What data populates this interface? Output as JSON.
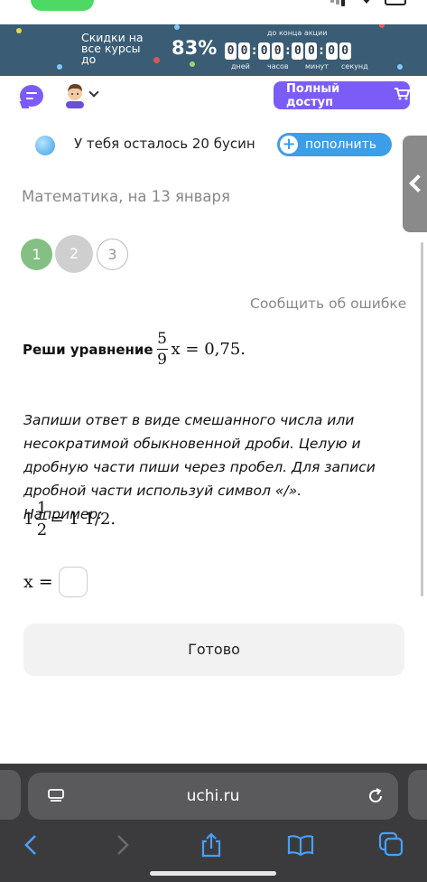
{
  "promo": {
    "title": "Скидки на все курсы до",
    "percent": "83%",
    "until_label": "до конца акции",
    "timer": {
      "days": [
        "0",
        "0"
      ],
      "hours": [
        "0",
        "0"
      ],
      "minutes": [
        "0",
        "0"
      ],
      "seconds": [
        "0",
        "0"
      ]
    },
    "unit_labels": {
      "days": "дней",
      "hours": "часов",
      "minutes": "минут",
      "seconds": "секунд"
    }
  },
  "header": {
    "full_access": "Полный доступ"
  },
  "beads": {
    "text": "У тебя осталось 20 бусин",
    "refill": "пополнить"
  },
  "lesson": {
    "title": "Математика, на 13 января",
    "steps": [
      "1",
      "2",
      "3"
    ],
    "report": "Сообщить об ошибке"
  },
  "task": {
    "prompt": "Реши уравнение",
    "frac_num": "5",
    "frac_den": "9",
    "rest": "x = 0,75.",
    "instruction": "Запиши ответ в виде смешанного числа или несократимой обыкновенной дроби. Целую и дробную части пиши через пробел. Для записи дробной части используй символ «/». Например:",
    "example_whole": "1",
    "example_num": "1",
    "example_den": "2",
    "example_rest": "= 1 1/2.",
    "answer_label": "x ="
  },
  "ready": "Готово",
  "browser": {
    "url": "uchi.ru"
  },
  "icons": {
    "chat": "chat-bubble-icon",
    "cart": "cart-icon",
    "back": "back-icon",
    "forward": "forward-icon",
    "share": "share-icon",
    "bookmarks": "bookmarks-icon",
    "tabs": "tabs-icon"
  },
  "colors": {
    "promo_bg": "#3a5d75",
    "accent": "#7c5cf6",
    "refill": "#3d9ee8",
    "step_done": "#84c084"
  }
}
